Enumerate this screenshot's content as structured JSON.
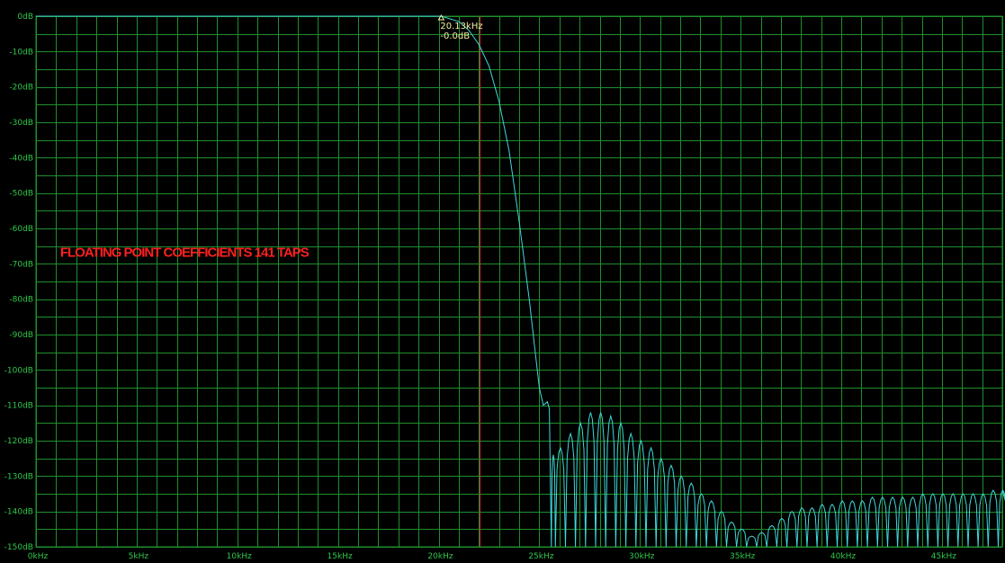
{
  "chart_data": {
    "type": "line",
    "title": "",
    "xlabel": "",
    "ylabel": "",
    "xlim": [
      0,
      48
    ],
    "ylim": [
      -150,
      0
    ],
    "x_unit": "kHz",
    "y_unit": "dB",
    "grid": true,
    "y_ticks": [
      "0dB",
      "-10dB",
      "-20dB",
      "-30dB",
      "-40dB",
      "-50dB",
      "-60dB",
      "-70dB",
      "-80dB",
      "-90dB",
      "-100dB",
      "-110dB",
      "-120dB",
      "-130dB",
      "-140dB",
      "-150dB"
    ],
    "y_tick_values": [
      0,
      -10,
      -20,
      -30,
      -40,
      -50,
      -60,
      -70,
      -80,
      -90,
      -100,
      -110,
      -120,
      -130,
      -140,
      -150
    ],
    "x_ticks": [
      "0kHz",
      "5kHz",
      "10kHz",
      "15kHz",
      "20kHz",
      "25kHz",
      "30kHz",
      "35kHz",
      "40kHz",
      "45kHz"
    ],
    "x_tick_values": [
      0,
      5,
      10,
      15,
      20,
      25,
      30,
      35,
      40,
      45
    ],
    "series": [
      {
        "color": "#3fd8d8",
        "passband": [
          [
            0,
            0
          ],
          [
            20,
            0
          ],
          [
            20.13,
            0
          ],
          [
            21.0,
            -1.5
          ],
          [
            21.5,
            -4
          ],
          [
            22.0,
            -8
          ],
          [
            22.5,
            -14
          ],
          [
            23.0,
            -24
          ],
          [
            23.5,
            -38
          ],
          [
            24.0,
            -58
          ],
          [
            24.5,
            -80
          ],
          [
            24.8,
            -95
          ],
          [
            25.0,
            -105
          ],
          [
            25.2,
            -110
          ],
          [
            25.4,
            -109
          ],
          [
            25.5,
            -111
          ]
        ],
        "stopband_lobes": [
          [
            25.6,
            -124
          ],
          [
            25.8,
            -122
          ],
          [
            26.3,
            -118
          ],
          [
            26.8,
            -115
          ],
          [
            27.3,
            -112
          ],
          [
            27.8,
            -112
          ],
          [
            28.3,
            -113
          ],
          [
            28.8,
            -115
          ],
          [
            29.3,
            -118
          ],
          [
            29.8,
            -120
          ],
          [
            30.3,
            -122
          ],
          [
            30.8,
            -125
          ],
          [
            31.3,
            -127
          ],
          [
            31.8,
            -130
          ],
          [
            32.3,
            -132
          ],
          [
            32.8,
            -135
          ],
          [
            33.3,
            -137
          ],
          [
            33.8,
            -140
          ],
          [
            34.3,
            -143
          ],
          [
            34.8,
            -145
          ],
          [
            35.3,
            -147
          ],
          [
            35.8,
            -146
          ],
          [
            36.3,
            -144
          ],
          [
            36.8,
            -142
          ],
          [
            37.3,
            -140
          ],
          [
            37.8,
            -139
          ],
          [
            38.3,
            -139
          ],
          [
            38.8,
            -138
          ],
          [
            39.3,
            -138
          ],
          [
            39.8,
            -137
          ],
          [
            40.3,
            -137
          ],
          [
            40.8,
            -137
          ],
          [
            41.3,
            -136
          ],
          [
            41.8,
            -136
          ],
          [
            42.3,
            -136
          ],
          [
            42.8,
            -136
          ],
          [
            43.3,
            -136
          ],
          [
            43.8,
            -135
          ],
          [
            44.3,
            -135
          ],
          [
            44.8,
            -135
          ],
          [
            45.3,
            -135
          ],
          [
            45.8,
            -135
          ],
          [
            46.3,
            -135
          ],
          [
            46.8,
            -135
          ],
          [
            47.3,
            -134
          ],
          [
            47.8,
            -134
          ]
        ]
      }
    ],
    "cursor": {
      "x": 22.05,
      "color": "#e0203a"
    },
    "marker": {
      "x": 20.13,
      "y": 0,
      "label_freq": "20.13kHz",
      "label_level": "-0.0dB"
    },
    "annotations": [
      {
        "text": "FLOATING POINT COEFFICIENTS 141 TAPS",
        "x": 1.2,
        "y": -68,
        "color": "#ff2020"
      }
    ]
  }
}
